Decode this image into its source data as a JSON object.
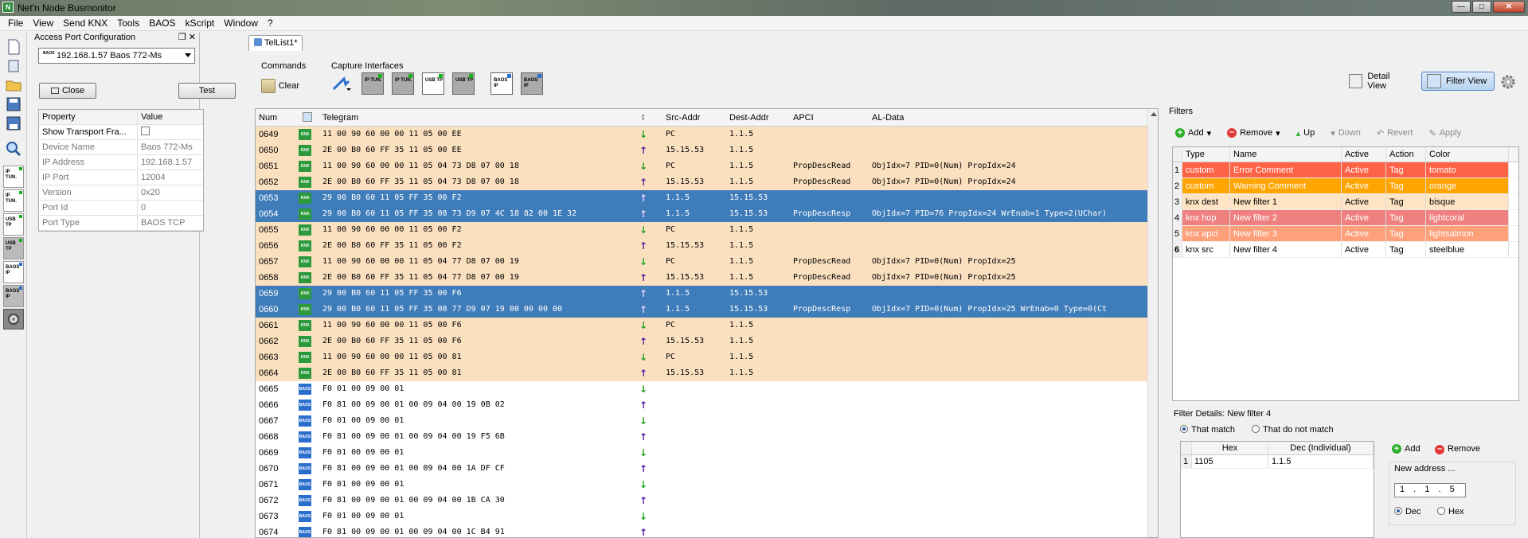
{
  "window": {
    "title": "Net'n Node Busmonitor",
    "app_icon": "N"
  },
  "menu": [
    "File",
    "View",
    "Send KNX",
    "Tools",
    "BAOS",
    "kScript",
    "Window",
    "?"
  ],
  "access_panel": {
    "title": "Access Port Configuration",
    "hdr_buttons": "❐ ✕",
    "selected_port": "192.168.1.57 Baos 772-Ms",
    "combo_icon_text": "BAOS",
    "close_label": "Close",
    "test_label": "Test",
    "prop_header": [
      "Property",
      "Value"
    ],
    "props": [
      {
        "k": "Show Transport Fra...",
        "v": ""
      },
      {
        "k": "Device Name",
        "v": "Baos 772-Ms"
      },
      {
        "k": "IP Address",
        "v": "192.168.1.57"
      },
      {
        "k": "IP Port",
        "v": "12004"
      },
      {
        "k": "Version",
        "v": "0x20"
      },
      {
        "k": "Port Id",
        "v": "0"
      },
      {
        "k": "Port Type",
        "v": "BAOS TCP"
      }
    ]
  },
  "left_caps": [
    "IP TUN.",
    "IP TUN.",
    "USB TP",
    "USB TP",
    "BAOS IP",
    "BAOS IP"
  ],
  "doc_tab": "TelList1*",
  "commands": {
    "label": "Commands",
    "clear": "Clear"
  },
  "capture": {
    "label": "Capture Interfaces",
    "buttons": [
      "IP TUN.",
      "IP TUN.",
      "USB TP",
      "USB TP",
      "BAOS IP",
      "BAOS IP"
    ]
  },
  "views": {
    "detail": "Detail View",
    "filter": "Filter View"
  },
  "table": {
    "headers": {
      "num": "Num",
      "telegram": "Telegram",
      "dir": "↕",
      "src": "Src-Addr",
      "dst": "Dest-Addr",
      "apci": "APCI",
      "al": "AL-Data"
    },
    "rows": [
      {
        "num": "0649",
        "type": "knx",
        "style": "tag",
        "tel": "11 00 90 60 00 00 11 05 00 EE",
        "dir": "in",
        "src": "PC",
        "dst": "1.1.5",
        "apci": "",
        "al": ""
      },
      {
        "num": "0650",
        "type": "knx",
        "style": "tag",
        "tel": "2E 00 B0 60 FF 35 11 05 00 EE",
        "dir": "out",
        "src": "15.15.53",
        "dst": "1.1.5",
        "apci": "",
        "al": ""
      },
      {
        "num": "0651",
        "type": "knx",
        "style": "tag",
        "tel": "11 00 90 60 00 00 11 05 04 73 D8 07 00 18",
        "dir": "in",
        "src": "PC",
        "dst": "1.1.5",
        "apci": "PropDescRead",
        "al": "ObjIdx=7 PID=0(Num) PropIdx=24"
      },
      {
        "num": "0652",
        "type": "knx",
        "style": "tag",
        "tel": "2E 00 B0 60 FF 35 11 05 04 73 D8 07 00 18",
        "dir": "out",
        "src": "15.15.53",
        "dst": "1.1.5",
        "apci": "PropDescRead",
        "al": "ObjIdx=7 PID=0(Num) PropIdx=24"
      },
      {
        "num": "0653",
        "type": "knx",
        "style": "sel",
        "tel": "29 00 B0 60 11 05 FF 35 00 F2",
        "dir": "out",
        "src": "1.1.5",
        "dst": "15.15.53",
        "apci": "",
        "al": ""
      },
      {
        "num": "0654",
        "type": "knx",
        "style": "sel",
        "tel": "29 00 B0 60 11 05 FF 35 08 73 D9 07 4C 18 82 00 1E 32",
        "dir": "out",
        "src": "1.1.5",
        "dst": "15.15.53",
        "apci": "PropDescResp",
        "al": "ObjIdx=7 PID=76 PropIdx=24 WrEnab=1 Type=2(UChar)"
      },
      {
        "num": "0655",
        "type": "knx",
        "style": "tag",
        "tel": "11 00 90 60 00 00 11 05 00 F2",
        "dir": "in",
        "src": "PC",
        "dst": "1.1.5",
        "apci": "",
        "al": ""
      },
      {
        "num": "0656",
        "type": "knx",
        "style": "tag",
        "tel": "2E 00 B0 60 FF 35 11 05 00 F2",
        "dir": "out",
        "src": "15.15.53",
        "dst": "1.1.5",
        "apci": "",
        "al": ""
      },
      {
        "num": "0657",
        "type": "knx",
        "style": "tag",
        "tel": "11 00 90 60 00 00 11 05 04 77 D8 07 00 19",
        "dir": "in",
        "src": "PC",
        "dst": "1.1.5",
        "apci": "PropDescRead",
        "al": "ObjIdx=7 PID=0(Num) PropIdx=25"
      },
      {
        "num": "0658",
        "type": "knx",
        "style": "tag",
        "tel": "2E 00 B0 60 FF 35 11 05 04 77 D8 07 00 19",
        "dir": "out",
        "src": "15.15.53",
        "dst": "1.1.5",
        "apci": "PropDescRead",
        "al": "ObjIdx=7 PID=0(Num) PropIdx=25"
      },
      {
        "num": "0659",
        "type": "knx",
        "style": "sel",
        "tel": "29 00 B0 60 11 05 FF 35 00 F6",
        "dir": "out",
        "src": "1.1.5",
        "dst": "15.15.53",
        "apci": "",
        "al": ""
      },
      {
        "num": "0660",
        "type": "knx",
        "style": "sel",
        "tel": "29 00 B0 60 11 05 FF 35 08 77 D9 07 19 00 00 00 00",
        "dir": "out",
        "src": "1.1.5",
        "dst": "15.15.53",
        "apci": "PropDescResp",
        "al": "ObjIdx=7 PID=0(Num) PropIdx=25 WrEnab=0 Type=0(Ct"
      },
      {
        "num": "0661",
        "type": "knx",
        "style": "tag",
        "tel": "11 00 90 60 00 00 11 05 00 F6",
        "dir": "in",
        "src": "PC",
        "dst": "1.1.5",
        "apci": "",
        "al": ""
      },
      {
        "num": "0662",
        "type": "knx",
        "style": "tag",
        "tel": "2E 00 B0 60 FF 35 11 05 00 F6",
        "dir": "out",
        "src": "15.15.53",
        "dst": "1.1.5",
        "apci": "",
        "al": ""
      },
      {
        "num": "0663",
        "type": "knx",
        "style": "tag",
        "tel": "11 00 90 60 00 00 11 05 00 81",
        "dir": "in",
        "src": "PC",
        "dst": "1.1.5",
        "apci": "",
        "al": ""
      },
      {
        "num": "0664",
        "type": "knx",
        "style": "tag",
        "tel": "2E 00 B0 60 FF 35 11 05 00 81",
        "dir": "out",
        "src": "15.15.53",
        "dst": "1.1.5",
        "apci": "",
        "al": ""
      },
      {
        "num": "0665",
        "type": "baos",
        "style": "plain",
        "tel": "F0 01 00 09 00 01",
        "dir": "in",
        "src": "",
        "dst": "",
        "apci": "",
        "al": ""
      },
      {
        "num": "0666",
        "type": "baos",
        "style": "plain",
        "tel": "F0 81 00 09 00 01 00 09 04 00 19 0B 02",
        "dir": "out",
        "src": "",
        "dst": "",
        "apci": "",
        "al": ""
      },
      {
        "num": "0667",
        "type": "baos",
        "style": "plain",
        "tel": "F0 01 00 09 00 01",
        "dir": "in",
        "src": "",
        "dst": "",
        "apci": "",
        "al": ""
      },
      {
        "num": "0668",
        "type": "baos",
        "style": "plain",
        "tel": "F0 81 00 09 00 01 00 09 04 00 19 F5 6B",
        "dir": "out",
        "src": "",
        "dst": "",
        "apci": "",
        "al": ""
      },
      {
        "num": "0669",
        "type": "baos",
        "style": "plain",
        "tel": "F0 01 00 09 00 01",
        "dir": "in",
        "src": "",
        "dst": "",
        "apci": "",
        "al": ""
      },
      {
        "num": "0670",
        "type": "baos",
        "style": "plain",
        "tel": "F0 81 00 09 00 01 00 09 04 00 1A DF CF",
        "dir": "out",
        "src": "",
        "dst": "",
        "apci": "",
        "al": ""
      },
      {
        "num": "0671",
        "type": "baos",
        "style": "plain",
        "tel": "F0 01 00 09 00 01",
        "dir": "in",
        "src": "",
        "dst": "",
        "apci": "",
        "al": ""
      },
      {
        "num": "0672",
        "type": "baos",
        "style": "plain",
        "tel": "F0 81 00 09 00 01 00 09 04 00 1B CA 30",
        "dir": "out",
        "src": "",
        "dst": "",
        "apci": "",
        "al": ""
      },
      {
        "num": "0673",
        "type": "baos",
        "style": "plain",
        "tel": "F0 01 00 09 00 01",
        "dir": "in",
        "src": "",
        "dst": "",
        "apci": "",
        "al": ""
      },
      {
        "num": "0674",
        "type": "baos",
        "style": "plain",
        "tel": "F0 81 00 09 00 01 00 09 04 00 1C B4 91",
        "dir": "out",
        "src": "",
        "dst": "",
        "apci": "",
        "al": ""
      }
    ]
  },
  "filters": {
    "title": "Filters",
    "toolbar": {
      "add": "Add",
      "remove": "Remove",
      "up": "Up",
      "down": "Down",
      "revert": "Revert",
      "apply": "Apply"
    },
    "headers": [
      "Type",
      "Name",
      "Active",
      "Action",
      "Color"
    ],
    "rows": [
      {
        "idx": "1",
        "type": "custom",
        "name": "Error Comment",
        "active": "Active",
        "action": "Tag",
        "color": "tomato",
        "bg": "#ff6347",
        "fg": "#ffffff"
      },
      {
        "idx": "2",
        "type": "custom",
        "name": "Warning Comment",
        "active": "Active",
        "action": "Tag",
        "color": "orange",
        "bg": "#ffa500",
        "fg": "#ffffff"
      },
      {
        "idx": "3",
        "type": "knx dest",
        "name": "New filter 1",
        "active": "Active",
        "action": "Tag",
        "color": "bisque",
        "bg": "#ffe4c4",
        "fg": "#000000"
      },
      {
        "idx": "4",
        "type": "knx hop",
        "name": "New filter 2",
        "active": "Active",
        "action": "Tag",
        "color": "lightcoral",
        "bg": "#f08080",
        "fg": "#ffffff"
      },
      {
        "idx": "5",
        "type": "knx apci",
        "name": "New filter 3",
        "active": "Active",
        "action": "Tag",
        "color": "lightsalmon",
        "bg": "#ffa07a",
        "fg": "#ffffff"
      },
      {
        "idx": "6",
        "type": "knx src",
        "name": "New filter 4",
        "active": "Active",
        "action": "Tag",
        "color": "steelblue",
        "bg": "#ffffff",
        "fg": "#000000"
      }
    ],
    "details": {
      "title": "Filter Details: New filter 4",
      "that_match": "That match",
      "not_match": "That do not match",
      "hex_header": "Hex",
      "dec_header": "Dec (Individual)",
      "row_idx": "1",
      "hex": "1105",
      "dec": "1.1.5",
      "add": "Add",
      "remove": "Remove",
      "new_address": "New address ...",
      "address_value": "1 . 1 . 5",
      "dec_label": "Dec",
      "hex_label": "Hex"
    }
  }
}
